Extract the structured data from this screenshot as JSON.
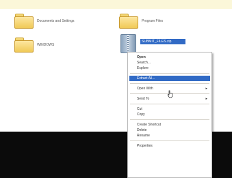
{
  "desktop_items": [
    {
      "label": "Documents and Settings",
      "icon": "folder-icon"
    },
    {
      "label": "Program Files",
      "icon": "folder-icon"
    },
    {
      "label": "WINDOWS",
      "icon": "folder-icon"
    },
    {
      "label": "SUBMIT_FILES.zip",
      "icon": "zip-folder-icon",
      "selected": true
    }
  ],
  "context_menu": {
    "open": "Open",
    "search": "Search...",
    "explore": "Explore",
    "extract_all": "Extract All...",
    "open_with": "Open With",
    "send_to": "Send To",
    "cut": "Cut",
    "copy": "Copy",
    "create_shortcut": "Create Shortcut",
    "delete": "Delete",
    "rename": "Rename",
    "properties": "Properties",
    "submenu_arrow": "▸"
  },
  "colors": {
    "selection": "#316ac5",
    "banner": "#fbf7d9",
    "folder": "#f0c957"
  }
}
